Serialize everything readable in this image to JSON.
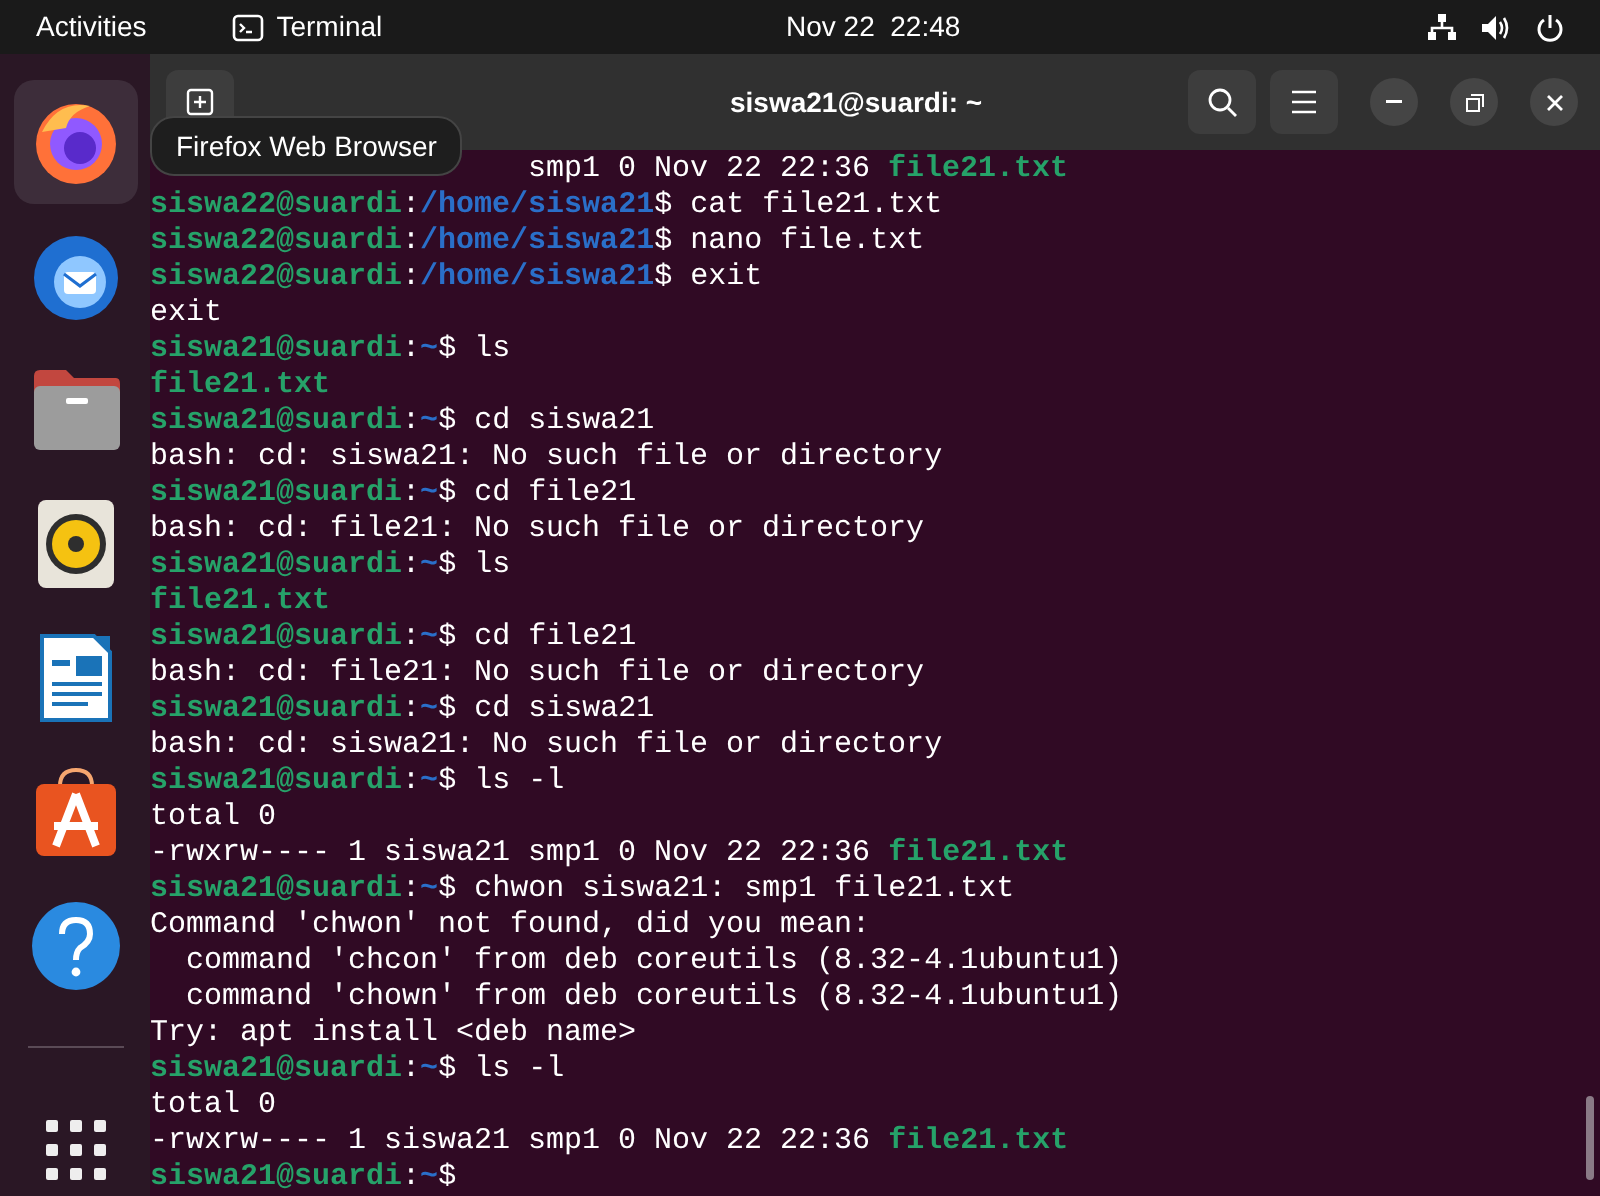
{
  "top_bar": {
    "activities": "Activities",
    "app": "Terminal",
    "clock": "Nov 22  22:48"
  },
  "dock": {
    "items": [
      {
        "kind": "firefox",
        "selected": true
      },
      {
        "kind": "mail",
        "selected": false
      },
      {
        "kind": "files",
        "selected": false
      },
      {
        "kind": "music",
        "selected": false
      },
      {
        "kind": "writer",
        "selected": false
      },
      {
        "kind": "store",
        "selected": false
      },
      {
        "kind": "help",
        "selected": false
      }
    ],
    "tooltip": "Firefox Web Browser"
  },
  "window": {
    "title": "siswa21@suardi: ~"
  },
  "lines": [
    {
      "kind": "covered",
      "segments": [
        {
          "kind": "plain",
          "text": "smp1 0 Nov 22 22:36 "
        },
        {
          "kind": "file",
          "text": "file21.txt"
        }
      ]
    },
    {
      "segments": [
        {
          "kind": "user",
          "text": "siswa22@suardi"
        },
        {
          "kind": "plain",
          "text": ":"
        },
        {
          "kind": "path",
          "text": "/home/siswa21"
        },
        {
          "kind": "plain",
          "text": "$ cat file21.txt"
        }
      ]
    },
    {
      "segments": [
        {
          "kind": "user",
          "text": "siswa22@suardi"
        },
        {
          "kind": "plain",
          "text": ":"
        },
        {
          "kind": "path",
          "text": "/home/siswa21"
        },
        {
          "kind": "plain",
          "text": "$ nano file.txt"
        }
      ]
    },
    {
      "segments": [
        {
          "kind": "user",
          "text": "siswa22@suardi"
        },
        {
          "kind": "plain",
          "text": ":"
        },
        {
          "kind": "path",
          "text": "/home/siswa21"
        },
        {
          "kind": "plain",
          "text": "$ exit"
        }
      ]
    },
    {
      "segments": [
        {
          "kind": "plain",
          "text": "exit"
        }
      ]
    },
    {
      "segments": [
        {
          "kind": "user",
          "text": "siswa21@suardi"
        },
        {
          "kind": "plain",
          "text": ":"
        },
        {
          "kind": "path",
          "text": "~"
        },
        {
          "kind": "plain",
          "text": "$ ls"
        }
      ]
    },
    {
      "segments": [
        {
          "kind": "file",
          "text": "file21.txt"
        }
      ]
    },
    {
      "segments": [
        {
          "kind": "user",
          "text": "siswa21@suardi"
        },
        {
          "kind": "plain",
          "text": ":"
        },
        {
          "kind": "path",
          "text": "~"
        },
        {
          "kind": "plain",
          "text": "$ cd siswa21"
        }
      ]
    },
    {
      "segments": [
        {
          "kind": "plain",
          "text": "bash: cd: siswa21: No such file or directory"
        }
      ]
    },
    {
      "segments": [
        {
          "kind": "user",
          "text": "siswa21@suardi"
        },
        {
          "kind": "plain",
          "text": ":"
        },
        {
          "kind": "path",
          "text": "~"
        },
        {
          "kind": "plain",
          "text": "$ cd file21"
        }
      ]
    },
    {
      "segments": [
        {
          "kind": "plain",
          "text": "bash: cd: file21: No such file or directory"
        }
      ]
    },
    {
      "segments": [
        {
          "kind": "user",
          "text": "siswa21@suardi"
        },
        {
          "kind": "plain",
          "text": ":"
        },
        {
          "kind": "path",
          "text": "~"
        },
        {
          "kind": "plain",
          "text": "$ ls"
        }
      ]
    },
    {
      "segments": [
        {
          "kind": "file",
          "text": "file21.txt"
        }
      ]
    },
    {
      "segments": [
        {
          "kind": "user",
          "text": "siswa21@suardi"
        },
        {
          "kind": "plain",
          "text": ":"
        },
        {
          "kind": "path",
          "text": "~"
        },
        {
          "kind": "plain",
          "text": "$ cd file21"
        }
      ]
    },
    {
      "segments": [
        {
          "kind": "plain",
          "text": "bash: cd: file21: No such file or directory"
        }
      ]
    },
    {
      "segments": [
        {
          "kind": "user",
          "text": "siswa21@suardi"
        },
        {
          "kind": "plain",
          "text": ":"
        },
        {
          "kind": "path",
          "text": "~"
        },
        {
          "kind": "plain",
          "text": "$ cd siswa21"
        }
      ]
    },
    {
      "segments": [
        {
          "kind": "plain",
          "text": "bash: cd: siswa21: No such file or directory"
        }
      ]
    },
    {
      "segments": [
        {
          "kind": "user",
          "text": "siswa21@suardi"
        },
        {
          "kind": "plain",
          "text": ":"
        },
        {
          "kind": "path",
          "text": "~"
        },
        {
          "kind": "plain",
          "text": "$ ls -l"
        }
      ]
    },
    {
      "segments": [
        {
          "kind": "plain",
          "text": "total 0"
        }
      ]
    },
    {
      "segments": [
        {
          "kind": "plain",
          "text": "-rwxrw---- 1 siswa21 smp1 0 Nov 22 22:36 "
        },
        {
          "kind": "file",
          "text": "file21.txt"
        }
      ]
    },
    {
      "segments": [
        {
          "kind": "user",
          "text": "siswa21@suardi"
        },
        {
          "kind": "plain",
          "text": ":"
        },
        {
          "kind": "path",
          "text": "~"
        },
        {
          "kind": "plain",
          "text": "$ chwon siswa21: smp1 file21.txt"
        }
      ]
    },
    {
      "segments": [
        {
          "kind": "plain",
          "text": "Command 'chwon' not found, did you mean:"
        }
      ]
    },
    {
      "segments": [
        {
          "kind": "plain",
          "text": "  command 'chcon' from deb coreutils (8.32-4.1ubuntu1)"
        }
      ]
    },
    {
      "segments": [
        {
          "kind": "plain",
          "text": "  command 'chown' from deb coreutils (8.32-4.1ubuntu1)"
        }
      ]
    },
    {
      "segments": [
        {
          "kind": "plain",
          "text": "Try: apt install <deb name>"
        }
      ]
    },
    {
      "segments": [
        {
          "kind": "user",
          "text": "siswa21@suardi"
        },
        {
          "kind": "plain",
          "text": ":"
        },
        {
          "kind": "path",
          "text": "~"
        },
        {
          "kind": "plain",
          "text": "$ ls -l"
        }
      ]
    },
    {
      "segments": [
        {
          "kind": "plain",
          "text": "total 0"
        }
      ]
    },
    {
      "segments": [
        {
          "kind": "plain",
          "text": "-rwxrw---- 1 siswa21 smp1 0 Nov 22 22:36 "
        },
        {
          "kind": "file",
          "text": "file21.txt"
        }
      ]
    },
    {
      "segments": [
        {
          "kind": "user",
          "text": "siswa21@suardi"
        },
        {
          "kind": "plain",
          "text": ":"
        },
        {
          "kind": "path",
          "text": "~"
        },
        {
          "kind": "plain",
          "text": "$"
        }
      ]
    }
  ]
}
